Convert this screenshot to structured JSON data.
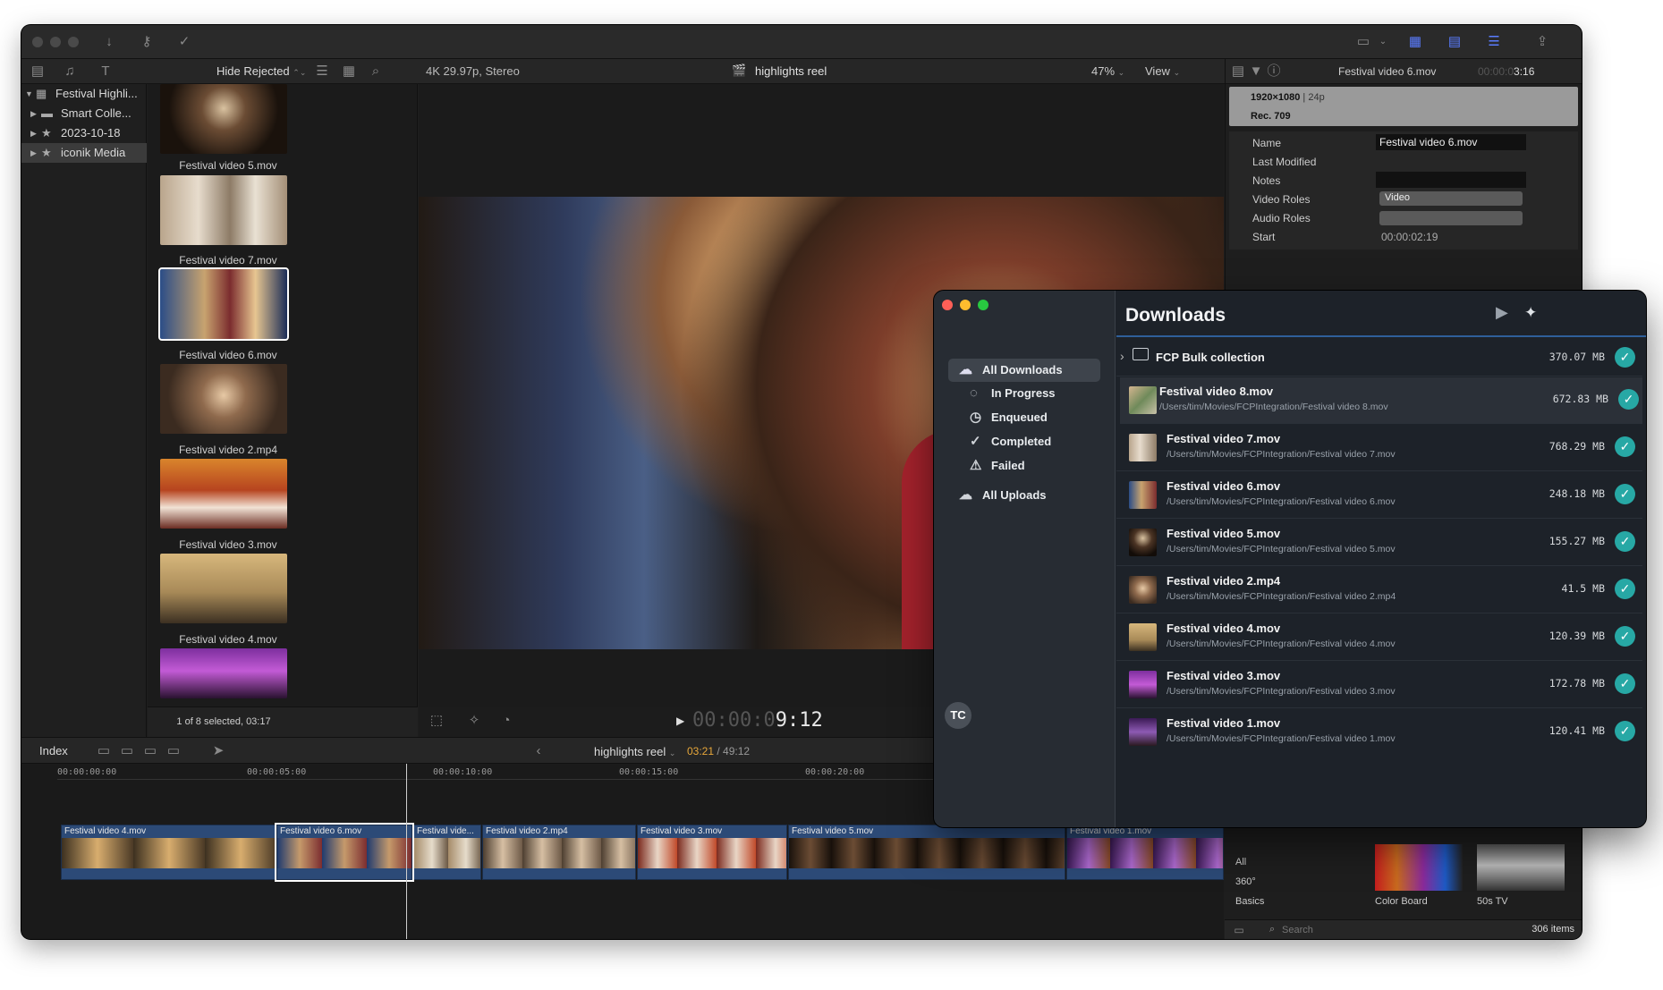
{
  "fcp": {
    "library": {
      "items": [
        {
          "label": "Festival Highli..."
        },
        {
          "label": "Smart Colle..."
        },
        {
          "label": "2023-10-18"
        },
        {
          "label": "iconik Media"
        }
      ]
    },
    "browser": {
      "filter_label": "Hide Rejected",
      "format_info": "4K 29.97p, Stereo",
      "selection_status": "1 of 8 selected, 03:17",
      "clips": [
        {
          "label": "Festival video 5.mov"
        },
        {
          "label": "Festival video 7.mov"
        },
        {
          "label": "Festival video 6.mov"
        },
        {
          "label": "Festival video 2.mp4"
        },
        {
          "label": "Festival video 3.mov"
        },
        {
          "label": "Festival video 4.mov"
        }
      ]
    },
    "viewer": {
      "project_name": "highlights reel",
      "zoom": "47%",
      "view_label": "View",
      "timecode_dim": "00:00:0",
      "timecode_bright": "9:12"
    },
    "inspector": {
      "clip_name": "Festival video 6.mov",
      "timecode_dim": "00:00:0",
      "timecode_bright": "3:16",
      "resolution": "1920×1080",
      "frame_rate": "24p",
      "color_space": "Rec. 709",
      "fields": [
        {
          "label": "Name",
          "value": "Festival video 6.mov"
        },
        {
          "label": "Last Modified",
          "value": ""
        },
        {
          "label": "Notes",
          "value": ""
        },
        {
          "label": "Video Roles",
          "value": "Video"
        },
        {
          "label": "Audio Roles",
          "value": ""
        },
        {
          "label": "Start",
          "value": "00:00:02:19"
        }
      ]
    },
    "timeline": {
      "index_label": "Index",
      "project_name": "highlights reel",
      "position": "03:21",
      "duration": "/ 49:12",
      "ruler": [
        "00:00:00:00",
        "00:00:05:00",
        "00:00:10:00",
        "00:00:15:00",
        "00:00:20:00"
      ],
      "clips": [
        {
          "label": "Festival video 4.mov"
        },
        {
          "label": "Festival video 6.mov"
        },
        {
          "label": "Festival vide..."
        },
        {
          "label": "Festival video 2.mp4"
        },
        {
          "label": "Festival video 3.mov"
        },
        {
          "label": "Festival video 5.mov"
        },
        {
          "label": "Festival video 1.mov"
        }
      ]
    },
    "effects": {
      "categories": [
        "All",
        "360°",
        "Basics"
      ],
      "items": [
        {
          "label": "Color Board"
        },
        {
          "label": "50s TV"
        }
      ],
      "search_placeholder": "Search",
      "count": "306 items"
    }
  },
  "downloads": {
    "title": "Downloads",
    "avatar_initials": "TC",
    "nav": [
      {
        "label": "All Downloads"
      },
      {
        "label": "In Progress"
      },
      {
        "label": "Enqueued"
      },
      {
        "label": "Completed"
      },
      {
        "label": "Failed"
      },
      {
        "label": "All Uploads"
      }
    ],
    "collection": {
      "name": "FCP Bulk collection",
      "size": "370.07 MB"
    },
    "files": [
      {
        "name": "Festival video 8.mov",
        "path": "/Users/tim/Movies/FCPIntegration/Festival video 8.mov",
        "size": "672.83 MB"
      },
      {
        "name": "Festival video 7.mov",
        "path": "/Users/tim/Movies/FCPIntegration/Festival video 7.mov",
        "size": "768.29 MB"
      },
      {
        "name": "Festival video 6.mov",
        "path": "/Users/tim/Movies/FCPIntegration/Festival video 6.mov",
        "size": "248.18 MB"
      },
      {
        "name": "Festival video 5.mov",
        "path": "/Users/tim/Movies/FCPIntegration/Festival video 5.mov",
        "size": "155.27 MB"
      },
      {
        "name": "Festival video 2.mp4",
        "path": "/Users/tim/Movies/FCPIntegration/Festival video 2.mp4",
        "size": "41.5 MB"
      },
      {
        "name": "Festival video 4.mov",
        "path": "/Users/tim/Movies/FCPIntegration/Festival video 4.mov",
        "size": "120.39 MB"
      },
      {
        "name": "Festival video 3.mov",
        "path": "/Users/tim/Movies/FCPIntegration/Festival video 3.mov",
        "size": "172.78 MB"
      },
      {
        "name": "Festival video 1.mov",
        "path": "/Users/tim/Movies/FCPIntegration/Festival video 1.mov",
        "size": "120.41 MB"
      }
    ]
  }
}
